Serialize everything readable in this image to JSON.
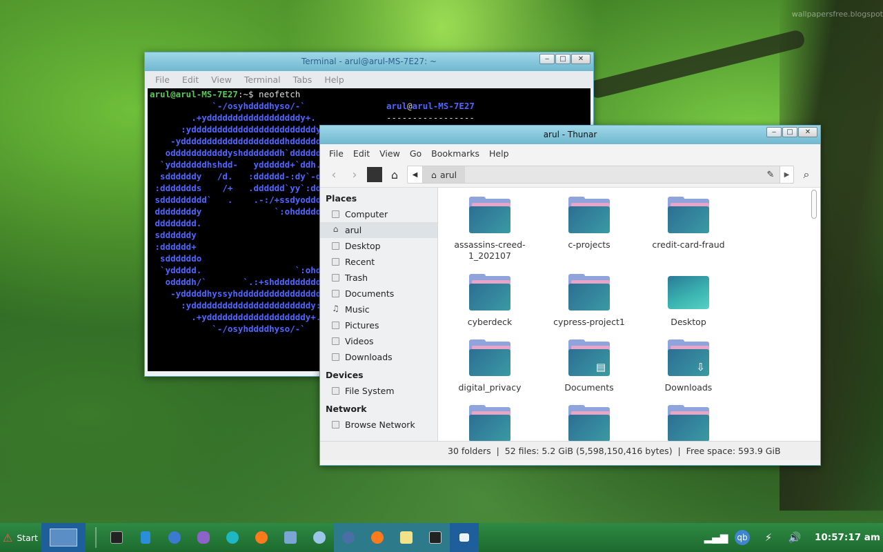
{
  "desktop": {
    "watermark": "wallpapersfree.blogspot"
  },
  "terminal": {
    "title": "Terminal - arul@arul-MS-7E27: ~",
    "menu": [
      "File",
      "Edit",
      "View",
      "Terminal",
      "Tabs",
      "Help"
    ],
    "prompt_user": "arul@arul-MS-7E27",
    "prompt_path": ":~$ ",
    "command": "neofetch",
    "ascii": [
      "            `-/osyhddddhyso/-`",
      "        .+yddddddddddddddddddy+.",
      "      :yddddddddddddddddddddddddy:",
      "    -yddddddddddddddddddddhdddddddy-",
      "   odddddddddddyshdddddddh`dddddddddo",
      "  `ydddddddhshdd-   ydddddd+`ddh.:dddddy`",
      "  sddddddy   /d.   :dddddd-:dy`-ddddddds",
      " :ddddddds    /+   .dddddd`yy`:ddddddddd:",
      " sddddddddd`   .    .-:/+ssdyodddddddddds",
      " ddddddddy              `:ohddddddddddd",
      " dddddddd.",
      " sddddddy",
      " :dddddd+",
      "  sddddddo                       ./ydd",
      "  `yddddd.                  `:ohdddd",
      "   oddddh/`       `.:+shdddddddddd",
      "    -ydddddhyssyhddddddddddddddddy-",
      "      :ydddddddddddddddddddddddy:",
      "        .+ydddddddddddddddddddy+.",
      "            `-/osyhddddhyso/-`"
    ],
    "info_user": "arul",
    "info_at": "@",
    "info_host": "arul-MS-7E27",
    "info_sep": "-----------------"
  },
  "thunar": {
    "title": "arul - Thunar",
    "menu": [
      "File",
      "Edit",
      "View",
      "Go",
      "Bookmarks",
      "Help"
    ],
    "path_crumb": "arul",
    "sections": {
      "places": "Places",
      "devices": "Devices",
      "network": "Network"
    },
    "places": [
      {
        "label": "Computer"
      },
      {
        "label": "arul"
      },
      {
        "label": "Desktop"
      },
      {
        "label": "Recent"
      },
      {
        "label": "Trash"
      },
      {
        "label": "Documents"
      },
      {
        "label": "Music"
      },
      {
        "label": "Pictures"
      },
      {
        "label": "Videos"
      },
      {
        "label": "Downloads"
      }
    ],
    "devices": [
      {
        "label": "File System"
      }
    ],
    "network": [
      {
        "label": "Browse Network"
      }
    ],
    "files": [
      {
        "name": "assassins-creed-1_202107"
      },
      {
        "name": "c-projects"
      },
      {
        "name": "credit-card-fraud"
      },
      {
        "name": "cyberdeck"
      },
      {
        "name": "cypress-project1"
      },
      {
        "name": "Desktop"
      },
      {
        "name": "digital_privacy"
      },
      {
        "name": "Documents"
      },
      {
        "name": "Downloads"
      },
      {
        "name": ""
      },
      {
        "name": ""
      },
      {
        "name": ""
      }
    ],
    "status": "30 folders  |  52 files: 5.2 GiB (5,598,150,416 bytes)  |  Free space: 593.9 GiB"
  },
  "taskbar": {
    "start_label": "Start",
    "clock": "10:57:17 am",
    "tray_qb": "qb"
  }
}
